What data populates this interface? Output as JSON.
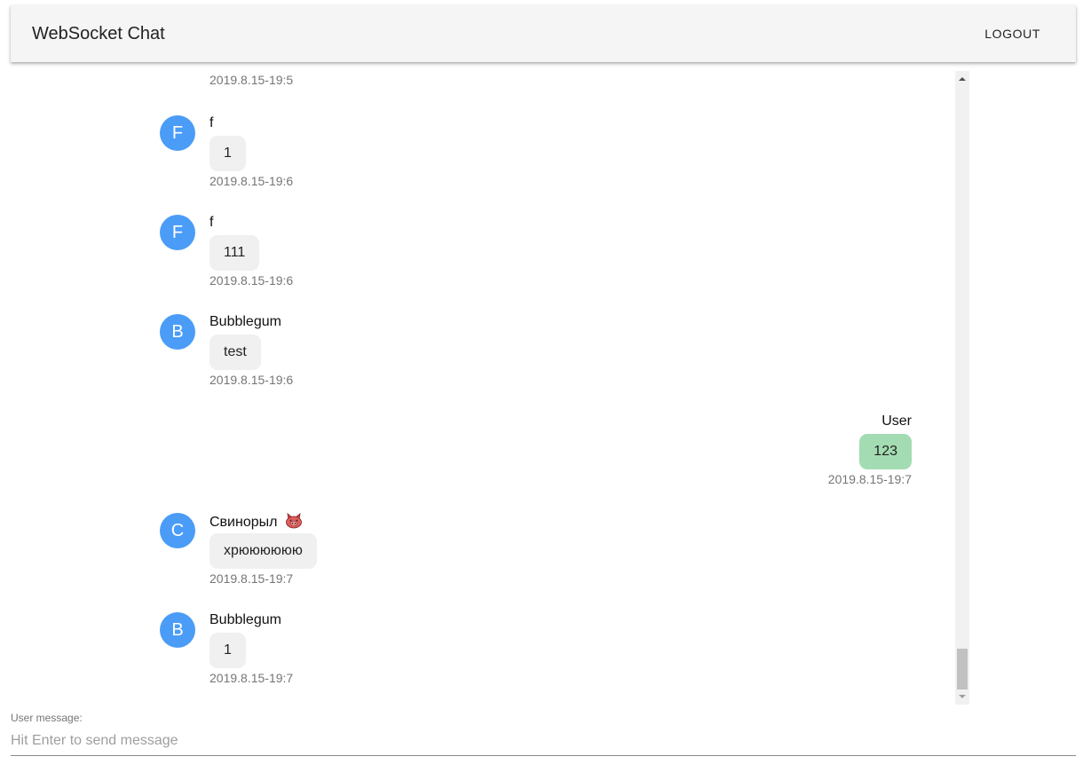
{
  "appbar": {
    "title": "WebSocket Chat",
    "logout_label": "LOGOUT"
  },
  "messages": [
    {
      "time": "2019.8.15-19:5"
    },
    {
      "avatar": "F",
      "sender": "f",
      "text": "1",
      "time": "2019.8.15-19:6"
    },
    {
      "avatar": "F",
      "sender": "f",
      "text": "111",
      "time": "2019.8.15-19:6"
    },
    {
      "avatar": "B",
      "sender": "Bubblegum",
      "text": "test",
      "time": "2019.8.15-19:6"
    },
    {
      "sender": "User",
      "text": "123",
      "time": "2019.8.15-19:7",
      "own": true
    },
    {
      "avatar": "C",
      "sender": "Свинорыл",
      "sender_icon": "pig-face-icon",
      "text": "хрюююююю",
      "time": "2019.8.15-19:7"
    },
    {
      "avatar": "B",
      "sender": "Bubblegum",
      "text": "1",
      "time": "2019.8.15-19:7"
    }
  ],
  "composer": {
    "label": "User message:",
    "placeholder": "Hit Enter to send message"
  },
  "colors": {
    "avatar": "#4a9cf7",
    "bubble_other": "#f0f0f0",
    "bubble_own": "#a3dcb2",
    "appbar": "#f5f5f5"
  }
}
